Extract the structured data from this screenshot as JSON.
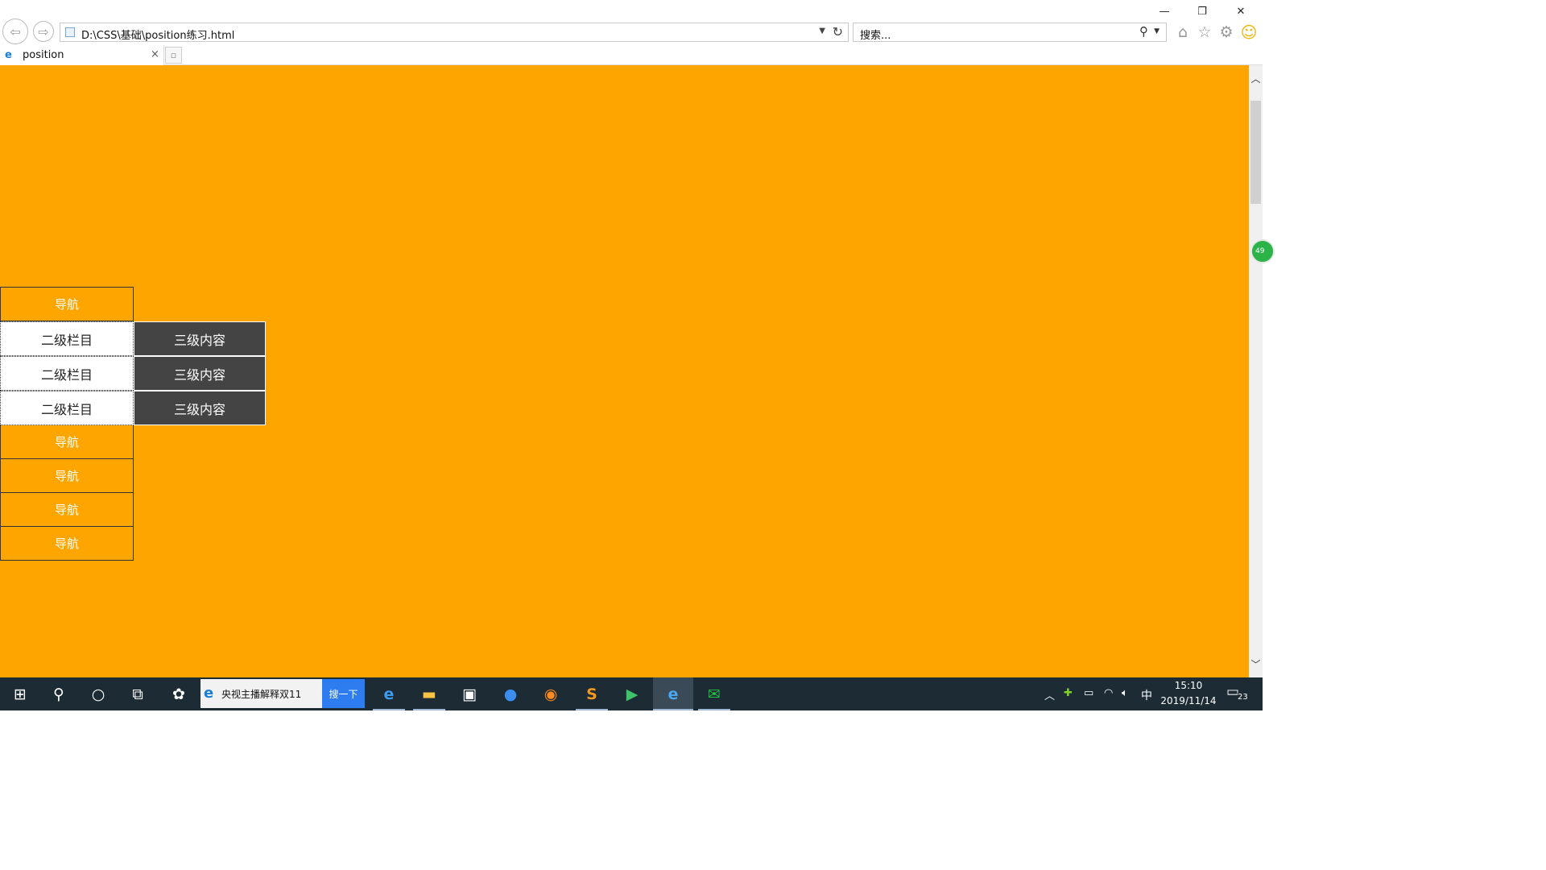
{
  "window": {
    "minimize_glyph": "—",
    "restore_glyph": "❐",
    "close_glyph": "✕"
  },
  "browser": {
    "back_glyph": "⇦",
    "forward_glyph": "⇨",
    "address": "D:\\CSS\\基础\\position练习.html",
    "search_placeholder": "搜索...",
    "tab_title": "position",
    "tab_close_glyph": "×",
    "icons": [
      "home-icon",
      "favorites-star-icon",
      "settings-gear-icon",
      "feedback-smiley-icon"
    ]
  },
  "page": {
    "background": "#ffa500",
    "nav_label": "导航",
    "second_level_label": "二级栏目",
    "third_level_label": "三级内容",
    "nav_items": [
      {
        "label": "导航"
      },
      {
        "label": "导航"
      },
      {
        "label": "导航"
      },
      {
        "label": "导航"
      },
      {
        "label": "导航"
      }
    ],
    "sub_items": [
      {
        "label": "二级栏目",
        "third": "三级内容"
      },
      {
        "label": "二级栏目",
        "third": "三级内容"
      },
      {
        "label": "二级栏目",
        "third": "三级内容"
      }
    ],
    "float_badge": "49"
  },
  "taskbar": {
    "search_text": "央视主播解释双11",
    "search_button": "搜一下",
    "input_method": "中",
    "time": "15:10",
    "date": "2019/11/14",
    "notifications": "23"
  }
}
